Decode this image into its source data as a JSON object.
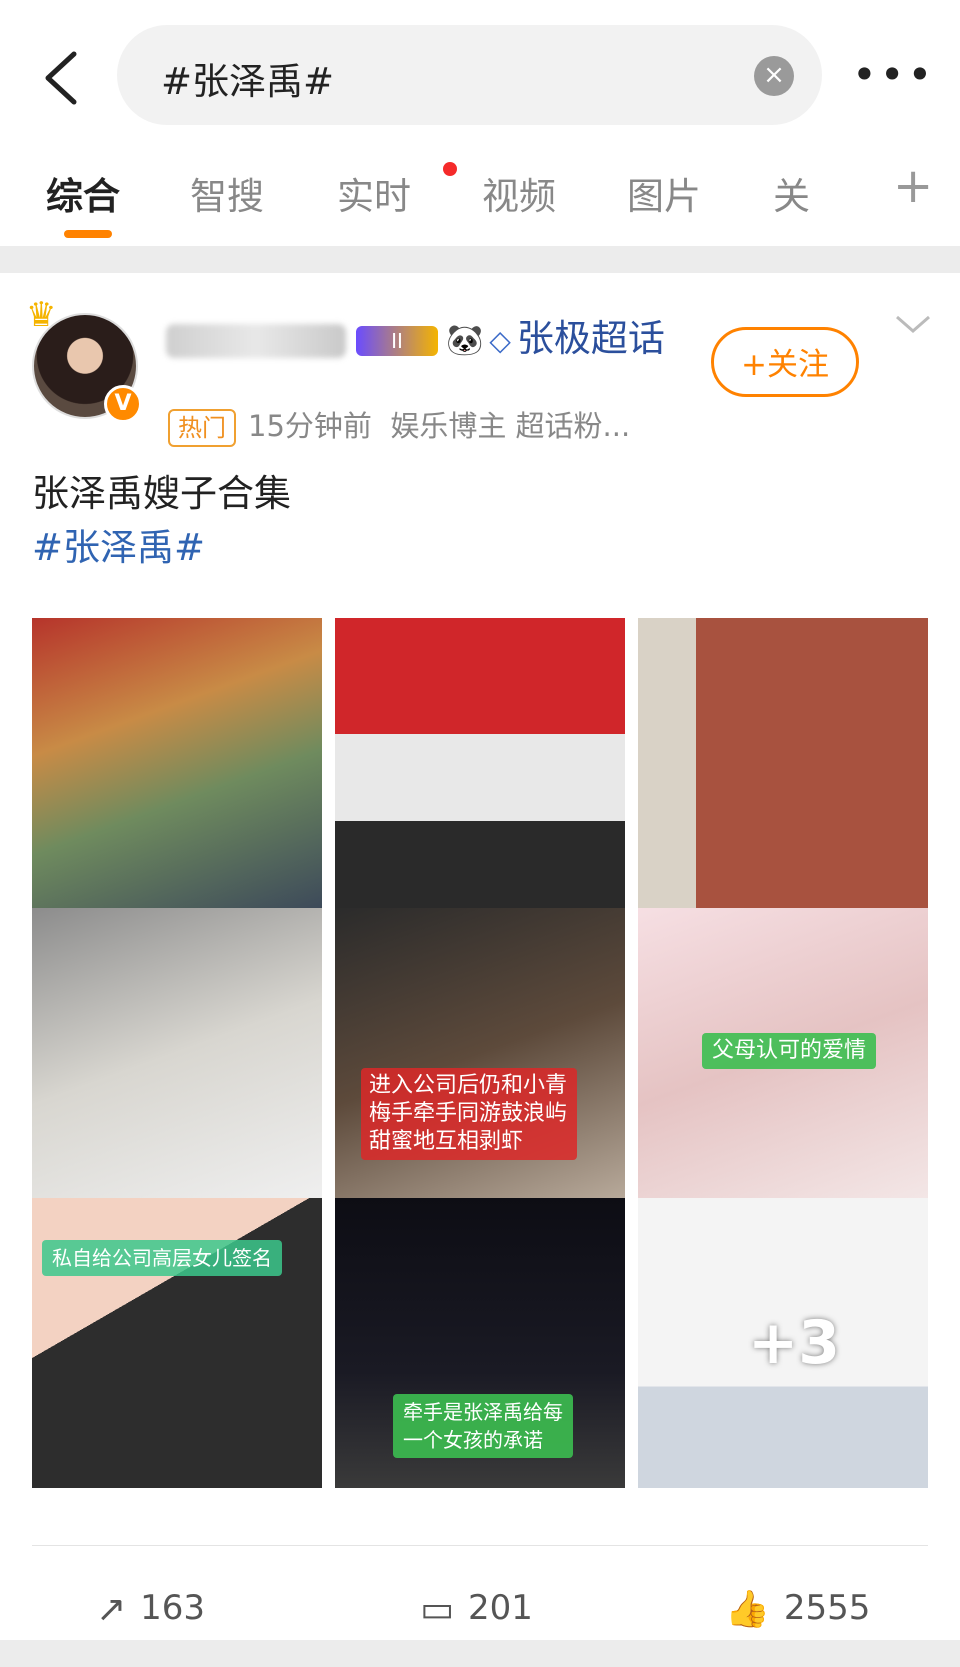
{
  "search": {
    "query": "#张泽禹#",
    "clear_label": "×",
    "more_label": "•••"
  },
  "tabs": [
    {
      "label": "综合",
      "active": true
    },
    {
      "label": "智搜"
    },
    {
      "label": "实时",
      "has_dot": true
    },
    {
      "label": "视频"
    },
    {
      "label": "图片"
    },
    {
      "label": "关"
    }
  ],
  "tab_add_label": "+",
  "post": {
    "author": {
      "name_suffix": "张极超话",
      "level_badge": "II",
      "verified_badge": "V"
    },
    "follow_label": "+关注",
    "hot_tag": "热门",
    "time": "15分钟前",
    "meta": "娱乐博主 超话粉...",
    "text": "张泽禹嫂子合集",
    "hashtag": "#张泽禹#",
    "images": [
      {
        "caption": ""
      },
      {
        "caption": ""
      },
      {
        "caption": ""
      },
      {
        "caption": ""
      },
      {
        "caption": "进入公司后仍和小青梅手牵手同游鼓浪屿甜蜜地互相剥虾"
      },
      {
        "caption": "父母认可的爱情"
      },
      {
        "caption": "私自给公司高层女儿签名"
      },
      {
        "caption": "牵手是张泽禹给每一个女孩的承诺"
      },
      {
        "caption": "+3"
      }
    ],
    "stats": {
      "reposts": "163",
      "comments": "201",
      "likes": "2555"
    }
  },
  "colors": {
    "accent": "#ff8200",
    "link": "#3064b2",
    "dot": "#f52a2a"
  }
}
